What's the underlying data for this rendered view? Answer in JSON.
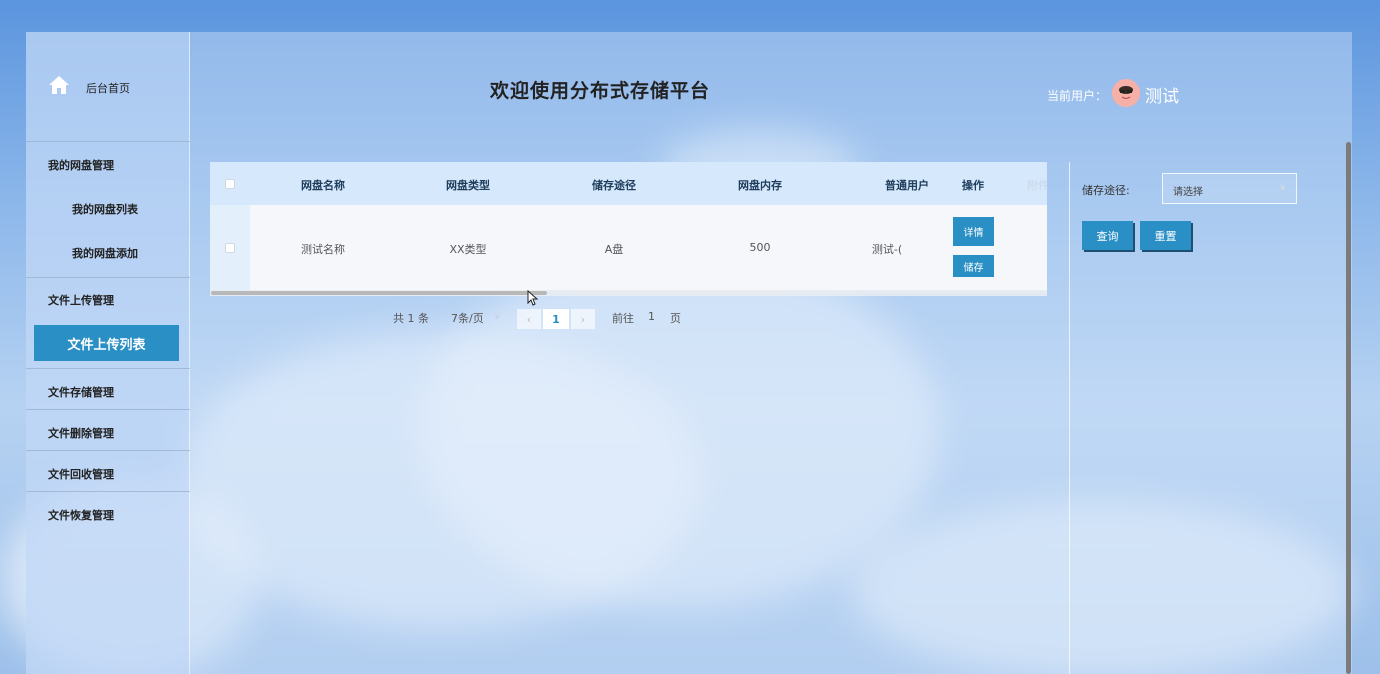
{
  "sidebar": {
    "home_label": "后台首页",
    "groups": [
      {
        "label": "我的网盘管理",
        "children": [
          "我的网盘列表",
          "我的网盘添加"
        ]
      },
      {
        "label": "文件上传管理",
        "children": [
          "文件上传列表"
        ]
      },
      {
        "label": "文件存储管理"
      },
      {
        "label": "文件删除管理"
      },
      {
        "label": "文件回收管理"
      },
      {
        "label": "文件恢复管理"
      }
    ],
    "active_item": "文件上传列表"
  },
  "header": {
    "title": "欢迎使用分布式存储平台",
    "user_label": "当前用户：",
    "user_name": "测试"
  },
  "table": {
    "columns": [
      "网盘名称",
      "网盘类型",
      "储存途径",
      "网盘内存",
      "普通用户",
      "操作",
      "附件"
    ],
    "rows": [
      {
        "name": "测试名称",
        "type": "XX类型",
        "path": "A盘",
        "memory": "500",
        "user": "测试-(",
        "actions": [
          "详情",
          "储存"
        ]
      }
    ]
  },
  "pagination": {
    "total": "共 1 条",
    "page_size": "7条/页",
    "current_page": "1",
    "goto_prefix": "前往",
    "goto_value": "1",
    "goto_suffix": "页"
  },
  "search": {
    "label": "储存途径:",
    "placeholder": "请选择",
    "query_label": "查询",
    "reset_label": "重置"
  },
  "colors": {
    "accent": "#2a8fc4",
    "header_row": "#d6e8fb"
  }
}
